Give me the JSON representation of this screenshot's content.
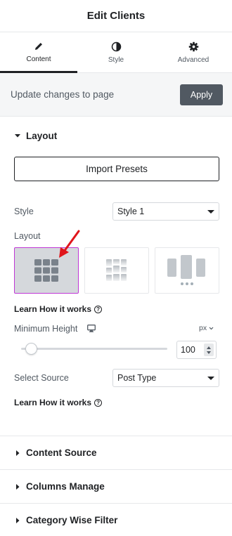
{
  "header": {
    "title": "Edit Clients"
  },
  "tabs": [
    {
      "label": "Content",
      "icon": "pencil-icon",
      "active": true
    },
    {
      "label": "Style",
      "icon": "contrast-icon",
      "active": false
    },
    {
      "label": "Advanced",
      "icon": "gear-icon",
      "active": false
    }
  ],
  "update_bar": {
    "text": "Update changes to page",
    "apply_label": "Apply"
  },
  "layout_section": {
    "title": "Layout",
    "import_label": "Import Presets",
    "style_label": "Style",
    "style_value": "Style 1",
    "layout_label": "Layout",
    "layout_options": [
      "grid",
      "masonry",
      "carousel"
    ],
    "selected_layout": "grid",
    "learn_label_1": "Learn How it works",
    "min_height_label": "Minimum Height",
    "min_height_value": "100",
    "min_height_unit": "px",
    "select_source_label": "Select Source",
    "select_source_value": "Post Type",
    "learn_label_2": "Learn How it works"
  },
  "collapsed_sections": [
    "Content Source",
    "Columns Manage",
    "Category Wise Filter"
  ],
  "colors": {
    "accent": "#c036d6",
    "annotation_arrow": "#e0151b",
    "apply_bg": "#515962"
  }
}
